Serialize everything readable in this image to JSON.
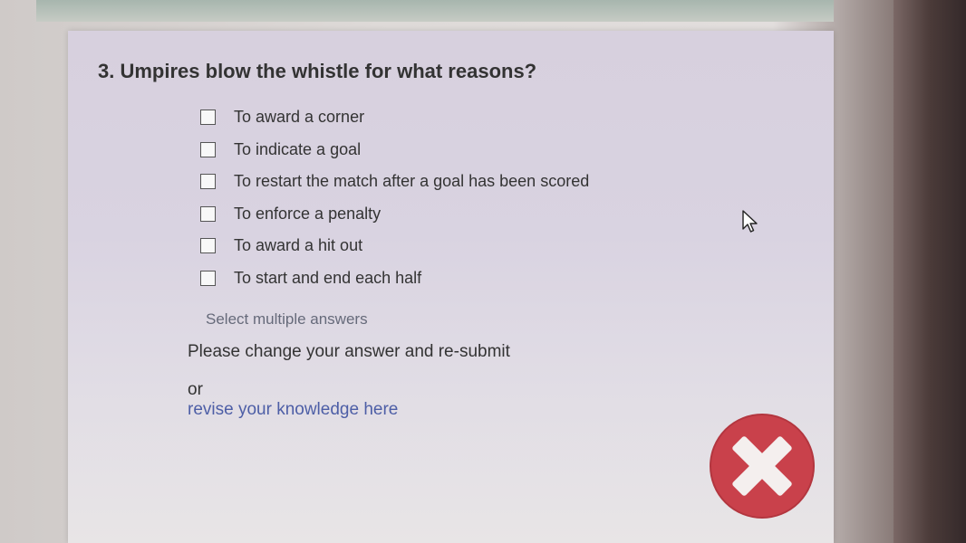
{
  "question": {
    "number": "3.",
    "text": "Umpires blow the whistle for what reasons?"
  },
  "options": [
    {
      "label": "To award a corner",
      "checked": false
    },
    {
      "label": "To indicate a goal",
      "checked": false
    },
    {
      "label": "To restart the match after a goal has been scored",
      "checked": false
    },
    {
      "label": "To enforce a penalty",
      "checked": false
    },
    {
      "label": "To award a hit out",
      "checked": false
    },
    {
      "label": "To start and end each half",
      "checked": false
    }
  ],
  "hint": "Select multiple answers",
  "feedback": {
    "message": "Please change your answer and re-submit",
    "or": "or",
    "link": "revise your knowledge here"
  },
  "icons": {
    "error": "error-x-icon",
    "cursor": "mouse-pointer-icon"
  },
  "colors": {
    "error_red": "#c9414b",
    "link_blue": "#4d5ea6",
    "panel_bg": "#d9d3e1"
  }
}
